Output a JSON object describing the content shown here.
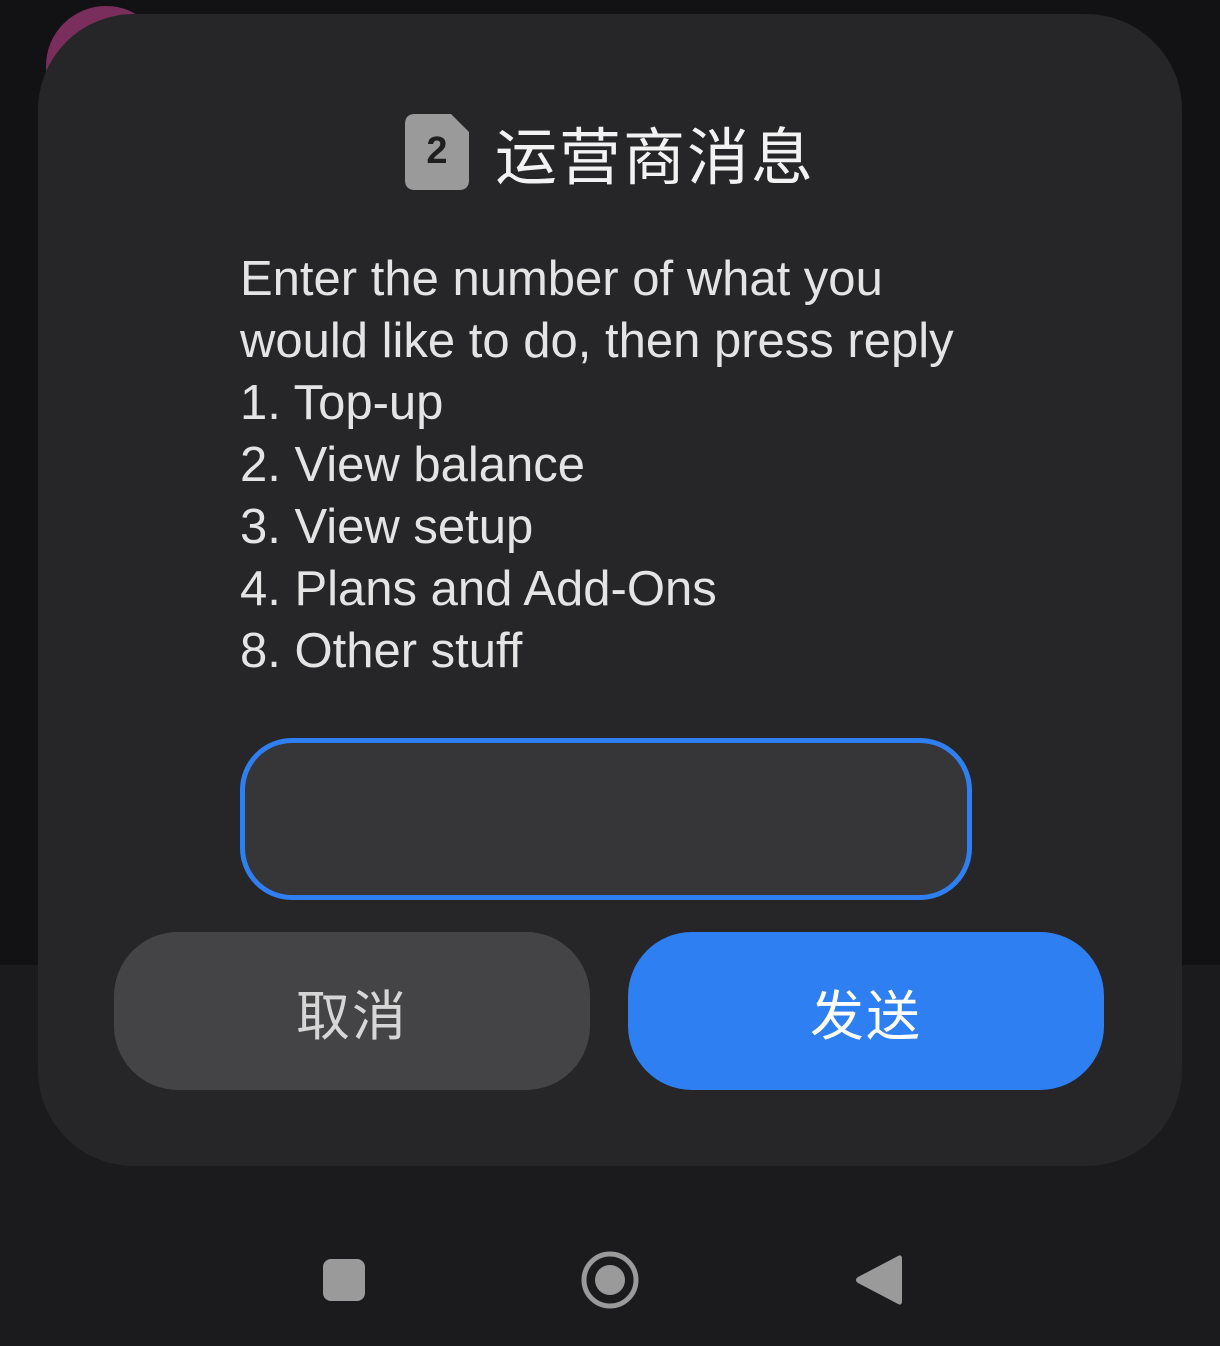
{
  "dialog": {
    "sim_number": "2",
    "title": "运营商消息",
    "message_lines": [
      "Enter the number of what you",
      "would like to do, then press reply",
      "1. Top-up",
      "2. View balance",
      "3. View setup",
      "4. Plans and Add-Ons",
      "8. Other stuff"
    ],
    "input": {
      "value": "",
      "placeholder": ""
    },
    "cancel_label": "取消",
    "send_label": "发送"
  },
  "navbar": {
    "buttons": [
      "recents-icon",
      "home-icon",
      "back-icon"
    ]
  },
  "colors": {
    "dialog_bg": "#262628",
    "accent": "#2d7ff2",
    "cancel_bg": "#444446",
    "text": "#e4e4e4"
  }
}
